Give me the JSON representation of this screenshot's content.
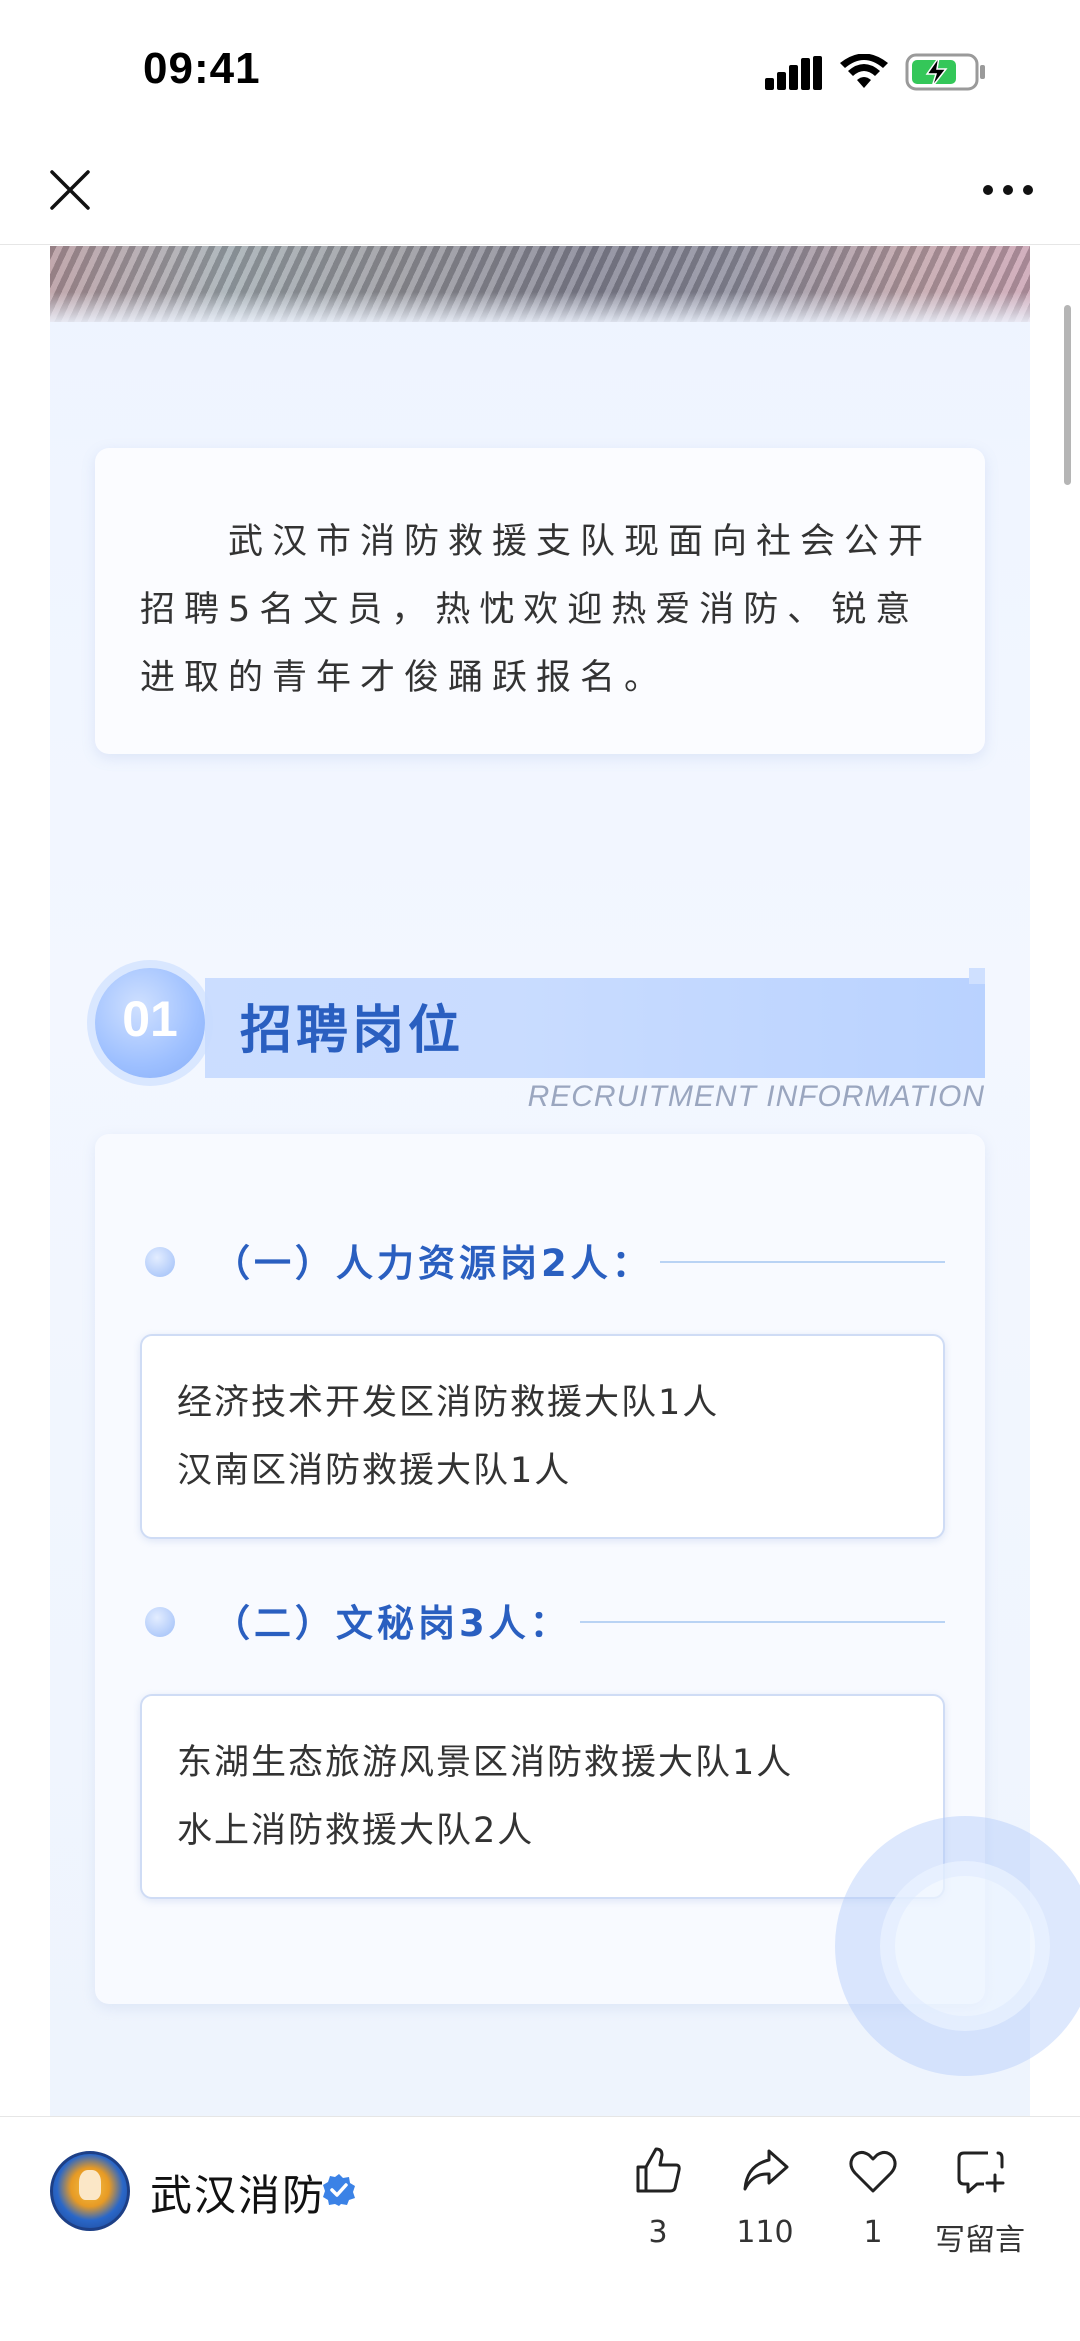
{
  "status_bar": {
    "time": "09:41"
  },
  "nav": {
    "close_icon": "close-icon",
    "more_icon": "more-icon"
  },
  "article": {
    "intro": "武汉市消防救援支队现面向社会公开招聘5名文员，热忱欢迎热爱消防、锐意进取的青年才俊踊跃报名。",
    "section": {
      "number": "01",
      "title": "招聘岗位",
      "subtitle": "RECRUITMENT INFORMATION"
    },
    "categories": [
      {
        "title": "（一）人力资源岗2人：",
        "lines": [
          "经济技术开发区消防救援大队1人",
          "汉南区消防救援大队1人"
        ]
      },
      {
        "title": "（二）文秘岗3人：",
        "lines": [
          "东湖生态旅游风景区消防救援大队1人",
          "水上消防救援大队2人"
        ]
      }
    ]
  },
  "bottom_bar": {
    "account_name": "武汉消防",
    "actions": {
      "like_count": "3",
      "share_count": "110",
      "love_count": "1",
      "comment_label": "写留言"
    }
  },
  "colors": {
    "accent_blue": "#2a5fc0",
    "poster_bg": "#eef4ff",
    "verified_blue": "#3b82e6"
  }
}
